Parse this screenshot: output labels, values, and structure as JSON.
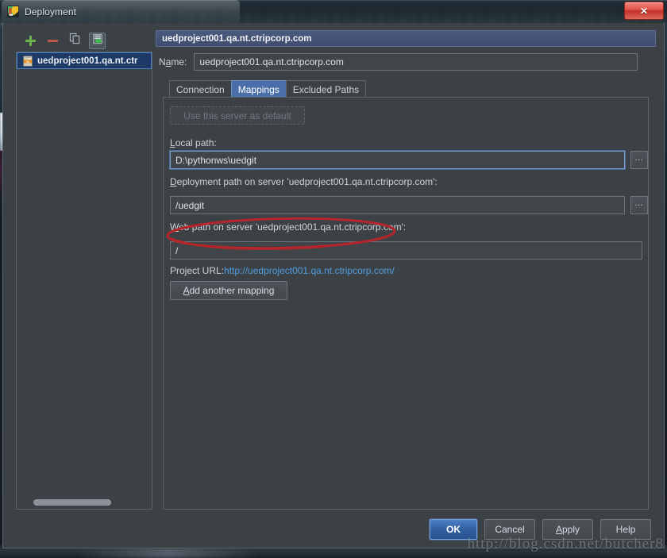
{
  "window": {
    "title": "Deployment",
    "app_icon": "pycharm-icon",
    "close_label": "✕"
  },
  "left_panel": {
    "toolbar": [
      {
        "name": "add-server-button",
        "icon": "plus-icon",
        "pressed": false
      },
      {
        "name": "remove-server-button",
        "icon": "minus-icon",
        "pressed": false
      },
      {
        "name": "copy-server-button",
        "icon": "copy-pages-icon",
        "pressed": false
      },
      {
        "name": "set-default-server-button",
        "icon": "server-stack-icon",
        "pressed": true
      }
    ],
    "tree_items": [
      {
        "label": "uedproject001.qa.nt.ctr",
        "icon": "ftp-server-icon",
        "selected": true
      }
    ]
  },
  "right_panel": {
    "header_title": "uedproject001.qa.nt.ctripcorp.com",
    "name_label": "Name:",
    "name_label_mnemonic": "a",
    "name_value": "uedproject001.qa.nt.ctripcorp.com",
    "tabs": [
      {
        "label": "Connection",
        "active": false
      },
      {
        "label": "Mappings",
        "active": true
      },
      {
        "label": "Excluded Paths",
        "active": false
      }
    ],
    "use_default_button": "Use this server as default",
    "use_default_disabled": true,
    "local_path_label": "Local path:",
    "local_path_value": "D:\\pythonws\\uedgit",
    "deployment_path_label": "Deployment path on server 'uedproject001.qa.nt.ctripcorp.com':",
    "deployment_path_value": "/uedgit",
    "web_path_label": "Web path on server 'uedproject001.qa.nt.ctripcorp.com':",
    "web_path_value": "/",
    "project_url_label": "Project URL:",
    "project_url_value": "http://uedproject001.qa.nt.ctripcorp.com/",
    "add_mapping_button": "Add another mapping",
    "browse_button_glyph": "…"
  },
  "footer": {
    "ok": "OK",
    "cancel": "Cancel",
    "apply": "Apply",
    "help": "Help"
  },
  "annotation": {
    "shape": "red-ellipse-highlight",
    "color": "#b5252b",
    "target": "deployment-path-input"
  },
  "watermark": {
    "text": "http://blog.csdn.net/butcher8"
  },
  "colors": {
    "dialog_bg": "#3c4146",
    "field_bg": "#3f4549",
    "accent_blue": "#4a6fa8",
    "selection_blue": "#1d3a66",
    "link_blue": "#4f9ee0",
    "annotation_red": "#b5252b",
    "close_red": "#c22f26",
    "add_green": "#6ab04c",
    "remove_red": "#c0564e"
  }
}
